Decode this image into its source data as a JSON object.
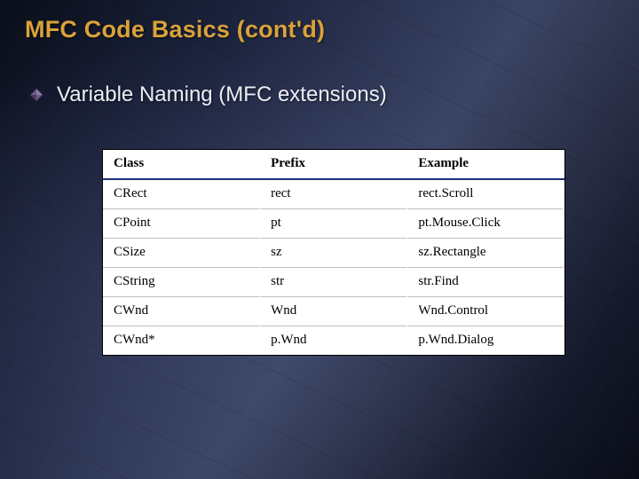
{
  "title": "MFC Code Basics (cont'd)",
  "subtitle": "Variable Naming (MFC extensions)",
  "bullet_icon": "diamond-bullet-icon",
  "table": {
    "headers": {
      "class": "Class",
      "prefix": "Prefix",
      "example": "Example"
    },
    "rows": [
      {
        "class": "CRect",
        "prefix": "rect",
        "example": "rect.Scroll"
      },
      {
        "class": "CPoint",
        "prefix": "pt",
        "example": "pt.Mouse.Click"
      },
      {
        "class": "CSize",
        "prefix": "sz",
        "example": "sz.Rectangle"
      },
      {
        "class": "CString",
        "prefix": "str",
        "example": "str.Find"
      },
      {
        "class": "CWnd",
        "prefix": "Wnd",
        "example": "Wnd.Control"
      },
      {
        "class": "CWnd*",
        "prefix": "p.Wnd",
        "example": "p.Wnd.Dialog"
      }
    ]
  }
}
